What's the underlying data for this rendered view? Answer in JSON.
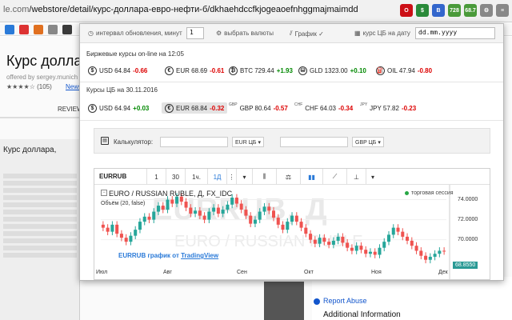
{
  "browser": {
    "url_host": "le.com",
    "url_path": "/webstore/detail/курс-доллара-евро-нефти-б/dkhaehdccfkjogeaoefnhggmajmaimdd",
    "extensions": [
      {
        "name": "opera-icon",
        "label": "O",
        "color": "#cc0f16"
      },
      {
        "name": "dollar-icon",
        "label": "$",
        "color": "#2a8a3a"
      },
      {
        "name": "b-icon",
        "label": "B",
        "color": "#3366cc"
      },
      {
        "name": "badge-728",
        "label": "728",
        "color": "#4a9a3a"
      },
      {
        "name": "badge-68-7",
        "label": "68.7",
        "color": "#4a9a3a"
      },
      {
        "name": "gear-icon",
        "label": "⚙",
        "color": "#888888"
      },
      {
        "name": "menu-icon",
        "label": "≡",
        "color": "#888888"
      }
    ]
  },
  "store": {
    "title": "Курс доллa",
    "offered": "offered by sergey.munich",
    "rating": "★★★★☆ (105)",
    "news": "News",
    "reviews_tab": "REVIEW",
    "thumb_title": "Курс доллара,",
    "report_abuse": "Report Abuse",
    "additional_info": "Additional Information"
  },
  "toolbar": {
    "interval_label": "интервал обновления, минут",
    "interval_value": "1",
    "choose_currency": "выбрать валюты",
    "chart_label": "График ✓",
    "cb_date_label": "курс ЦБ на дату",
    "date_placeholder": "dd.mm.yyyy"
  },
  "exchange": {
    "title": "Биржевые курсы on-line на 12:05",
    "rates": [
      {
        "icon": "$",
        "name": "USD",
        "value": "64.84",
        "change": "-0.66",
        "dir": "neg"
      },
      {
        "icon": "€",
        "name": "EUR",
        "value": "68.69",
        "change": "-0.61",
        "dir": "neg"
      },
      {
        "icon": "₿",
        "name": "BTC",
        "value": "729.44",
        "change": "+1.93",
        "dir": "pos"
      },
      {
        "icon": "⛁",
        "name": "GLD",
        "value": "1323.00",
        "change": "+0.10",
        "dir": "pos"
      },
      {
        "icon": "⛽",
        "name": "OIL",
        "value": "47.94",
        "change": "-0.80",
        "dir": "neg"
      }
    ]
  },
  "cb": {
    "title": "Курсы ЦБ на 30.11.2016",
    "rates": [
      {
        "icon": "$",
        "name": "USD",
        "value": "64.94",
        "change": "+0.03",
        "dir": "pos",
        "sup": ""
      },
      {
        "icon": "€",
        "name": "EUR",
        "value": "68.84",
        "change": "-0.32",
        "dir": "neg",
        "sup": ""
      },
      {
        "icon": "",
        "name": "GBP",
        "value": "80.64",
        "change": "-0.57",
        "dir": "neg",
        "sup": "GBP"
      },
      {
        "icon": "",
        "name": "CHF",
        "value": "64.03",
        "change": "-0.34",
        "dir": "neg",
        "sup": "CHF"
      },
      {
        "icon": "",
        "name": "JPY",
        "value": "57.82",
        "change": "-0.23",
        "dir": "neg",
        "sup": "JPY"
      }
    ]
  },
  "calculator": {
    "label": "Калькулятор:",
    "from_currency": "EUR ЦБ",
    "to_currency": "GBP ЦБ"
  },
  "chart": {
    "symbol": "EURRUB",
    "intervals": [
      "1",
      "30",
      "1ч.",
      "1Д"
    ],
    "active_interval": "1Д",
    "title": "EURO / RUSSIAN RUBLE, Д, FX_IDC",
    "volume": "Объём (20, false)",
    "session": "торговая сессия",
    "watermark_symbol": "EURRUB, Д",
    "watermark_name": "EURO / RUSSIAN RUBLE",
    "credit_prefix": "EURRUB график от",
    "credit_link": "TradingView",
    "last_price": "68.8550",
    "colors": {
      "up": "#26a69a",
      "down": "#ef5350",
      "last": "#2a9a95",
      "accent": "#2a7ad8"
    }
  },
  "chart_data": {
    "type": "candlestick",
    "x_labels": [
      "Июл",
      "Авг",
      "Сен",
      "Окт",
      "Ноя",
      "Дек"
    ],
    "y_ticks": [
      "74.0000",
      "72.0000",
      "70.0000"
    ],
    "ylim": [
      67.5,
      75
    ],
    "closes": [
      71.2,
      70.8,
      71.5,
      70.6,
      70.2,
      69.8,
      70.4,
      71.0,
      71.8,
      72.3,
      72.0,
      72.8,
      73.4,
      73.0,
      74.0,
      73.6,
      74.3,
      73.8,
      73.2,
      72.6,
      72.9,
      72.4,
      72.0,
      72.8,
      73.2,
      72.6,
      73.0,
      73.5,
      74.2,
      73.6,
      73.0,
      72.4,
      71.6,
      72.0,
      72.8,
      73.3,
      72.9,
      72.2,
      71.5,
      71.0,
      71.8,
      72.4,
      71.8,
      71.2,
      70.6,
      70.0,
      69.6,
      70.2,
      69.8,
      69.5,
      69.9,
      70.3,
      69.7,
      69.2,
      68.9,
      69.4,
      69.0,
      68.6,
      68.8,
      68.5,
      69.2,
      69.8,
      70.5,
      71.2,
      70.8,
      70.3,
      69.9,
      69.4,
      68.9,
      68.4,
      68.0,
      68.3,
      68.6,
      68.9,
      68.85
    ]
  }
}
